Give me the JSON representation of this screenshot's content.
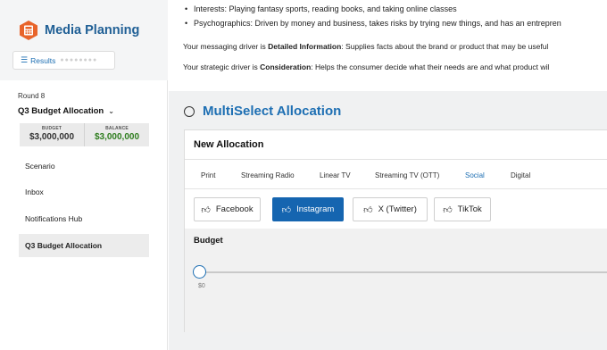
{
  "sidebar": {
    "brand_title": "Media Planning",
    "results_label": "Results",
    "round_label": "Round 8",
    "allocation_selector": "Q3 Budget Allocation",
    "budget": {
      "label": "BUDGET",
      "value": "$3,000,000"
    },
    "balance": {
      "label": "BALANCE",
      "value": "$3,000,000"
    },
    "nav": [
      {
        "label": "Scenario"
      },
      {
        "label": "Inbox"
      },
      {
        "label": "Notifications Hub"
      },
      {
        "label": "Q3 Budget Allocation"
      }
    ]
  },
  "intro": {
    "bullets": [
      "Interests: Playing fantasy sports, reading books, and taking online classes",
      "Psychographics: Driven by money and business, takes risks by trying new things, and has an entrepren"
    ],
    "messaging": {
      "prefix": "Your messaging driver is ",
      "term": "Detailed Information",
      "suffix": ": Supplies facts about the brand or product that may be useful"
    },
    "strategic": {
      "prefix": "Your strategic driver is ",
      "term": "Consideration",
      "suffix": ": Helps the consumer decide what their needs are and what product wil"
    }
  },
  "section": {
    "title": "MultiSelect Allocation",
    "card_title": "New Allocation",
    "tabs": [
      {
        "label": "Print"
      },
      {
        "label": "Streaming Radio"
      },
      {
        "label": "Linear TV"
      },
      {
        "label": "Streaming TV (OTT)"
      },
      {
        "label": "Social"
      },
      {
        "label": "Digital"
      }
    ],
    "active_tab": "Social",
    "channels": [
      {
        "label": "Facebook"
      },
      {
        "label": "Instagram"
      },
      {
        "label": "X (Twitter)"
      },
      {
        "label": "TikTok"
      }
    ],
    "selected_channel": "Instagram",
    "budget_title": "Budget",
    "slider_value": "$0",
    "slider_fraction": 0
  },
  "icons": {
    "brand": "calculator-icon",
    "results": "menu-icon",
    "chevron": "chevron-down-icon",
    "chip": "thumbs-up-icon"
  },
  "colors": {
    "brand": "#1f5f95",
    "accent": "#1e6fb3",
    "active_chip": "#1565b0",
    "balance": "#2e7d1e",
    "logo_orange": "#e8642a"
  }
}
